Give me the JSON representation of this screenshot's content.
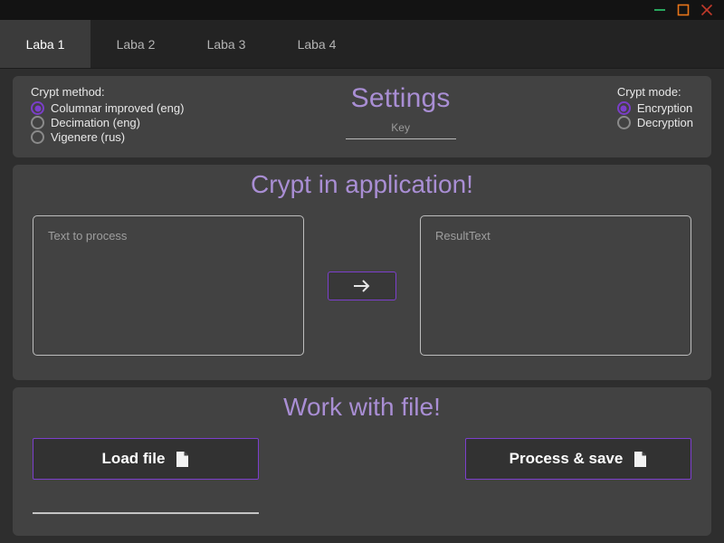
{
  "window": {
    "controls": [
      {
        "name": "minimize",
        "glyph": "minimize-icon",
        "color": "#2ecc71"
      },
      {
        "name": "maximize",
        "glyph": "maximize-icon",
        "color": "#e8751a"
      },
      {
        "name": "close",
        "glyph": "close-icon",
        "color": "#c0392b"
      }
    ]
  },
  "tabs": [
    {
      "label": "Laba 1",
      "active": true
    },
    {
      "label": "Laba 2",
      "active": false
    },
    {
      "label": "Laba 3",
      "active": false
    },
    {
      "label": "Laba 4",
      "active": false
    }
  ],
  "settings": {
    "title": "Settings",
    "accent_color": "#a98ed4",
    "method": {
      "title": "Crypt method:",
      "options": [
        {
          "label": "Columnar improved (eng)",
          "selected": true
        },
        {
          "label": "Decimation (eng)",
          "selected": false
        },
        {
          "label": "Vigenere (rus)",
          "selected": false
        }
      ]
    },
    "mode": {
      "title": "Crypt mode:",
      "options": [
        {
          "label": "Encryption",
          "selected": true
        },
        {
          "label": "Decryption",
          "selected": false
        }
      ]
    },
    "key_field": {
      "placeholder": "Key",
      "value": ""
    }
  },
  "crypt": {
    "title": "Crypt in application!",
    "input": {
      "placeholder": "Text to process",
      "value": ""
    },
    "output": {
      "placeholder": "ResultText",
      "value": ""
    },
    "process_button": {
      "icon": "arrow-right-icon",
      "label": ""
    }
  },
  "file": {
    "title": "Work with file!",
    "load_button": {
      "label": "Load file",
      "icon": "file-icon"
    },
    "save_button": {
      "label": "Process & save",
      "icon": "file-icon"
    },
    "path_field": {
      "placeholder": "",
      "value": ""
    }
  }
}
